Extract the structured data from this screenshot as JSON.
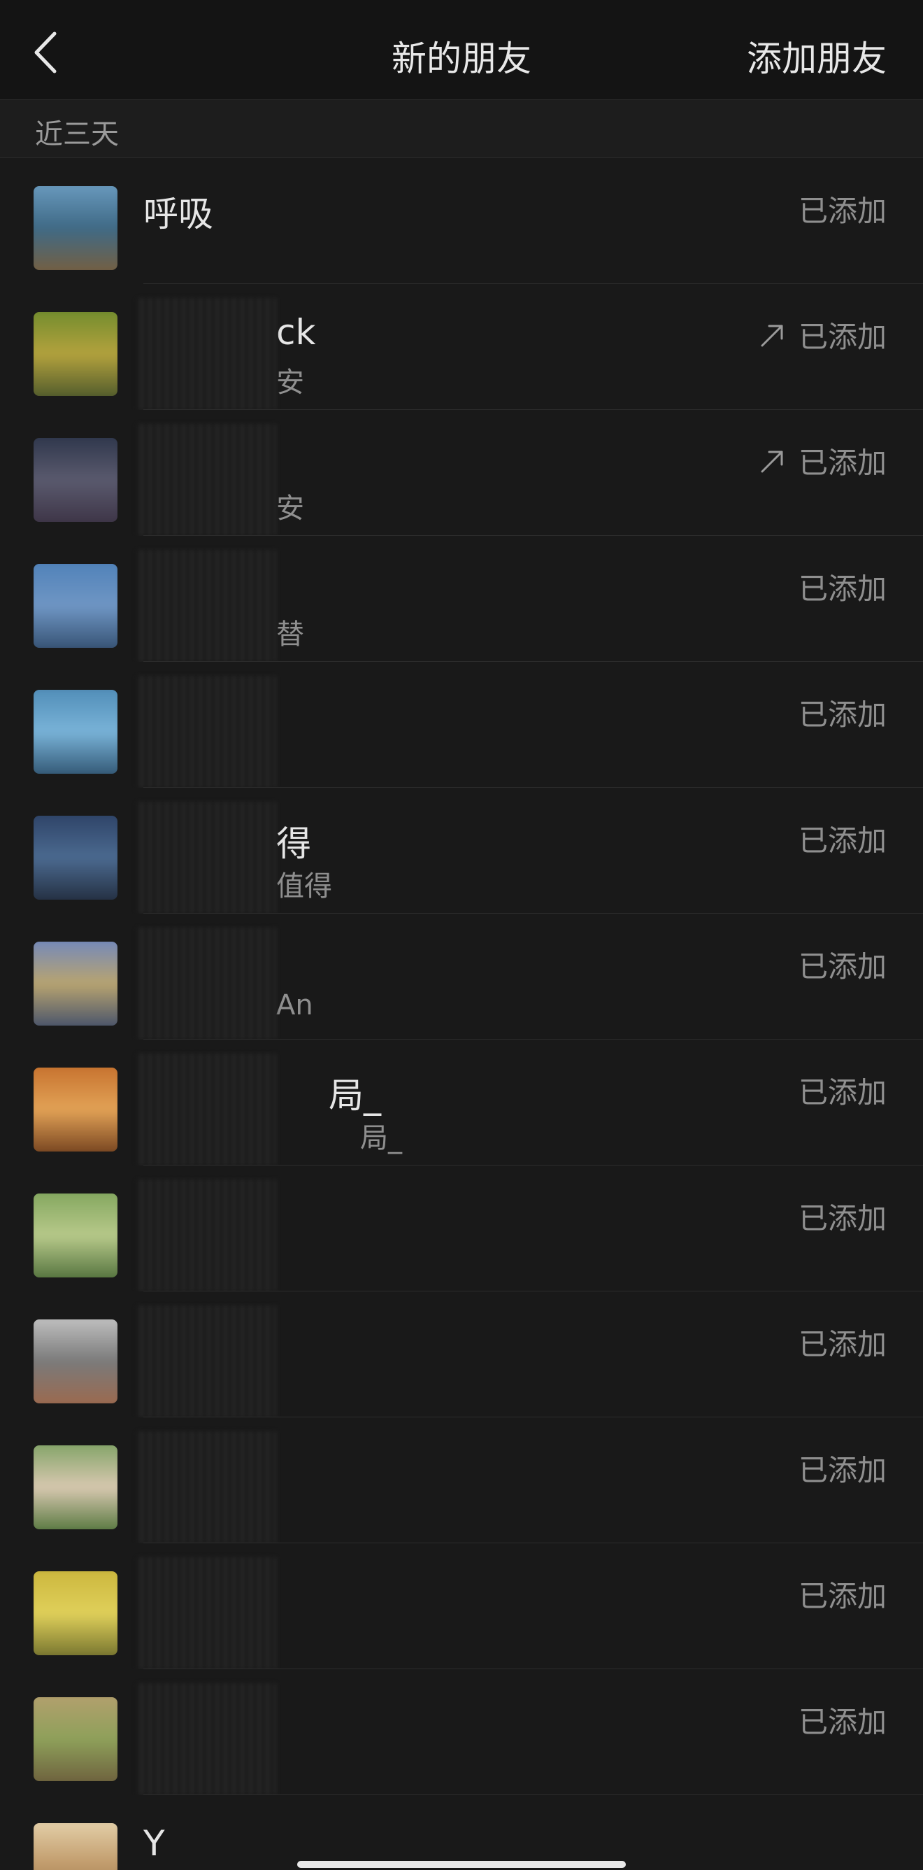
{
  "header": {
    "title": "新的朋友",
    "action_label": "添加朋友"
  },
  "section": {
    "title": "近三天"
  },
  "friends": [
    {
      "name": "呼吸",
      "sub": "",
      "status": "已添加",
      "share": false,
      "avatar_colors": [
        "#6e9fc4",
        "#3f6a86",
        "#7b5e3a"
      ]
    },
    {
      "name": "ck",
      "sub": "安",
      "status": "已添加",
      "share": true,
      "avatar_colors": [
        "#6b8a2c",
        "#b3a23d",
        "#46532a"
      ]
    },
    {
      "name": "",
      "sub": "安",
      "status": "已添加",
      "share": true,
      "avatar_colors": [
        "#2a3348",
        "#5a5a6e",
        "#3a3042"
      ]
    },
    {
      "name": "",
      "sub": "替",
      "status": "已添加",
      "share": false,
      "avatar_colors": [
        "#4d80b8",
        "#6f96c4",
        "#2f4a6a"
      ]
    },
    {
      "name": "",
      "sub": "",
      "status": "已添加",
      "share": false,
      "avatar_colors": [
        "#4c89b4",
        "#79b3d8",
        "#2a4d69"
      ]
    },
    {
      "name": "得",
      "sub": "值得",
      "status": "已添加",
      "share": false,
      "avatar_colors": [
        "#2b3f63",
        "#4b6a90",
        "#1f2838"
      ]
    },
    {
      "name": "",
      "sub": "An",
      "status": "已添加",
      "share": false,
      "avatar_colors": [
        "#6c86c4",
        "#b8a470",
        "#3c4a6a"
      ]
    },
    {
      "name": "局_",
      "sub": "局_",
      "status": "已添加",
      "share": false,
      "avatar_colors": [
        "#c46d2a",
        "#e2a256",
        "#6b3a1a"
      ]
    },
    {
      "name": "",
      "sub": "",
      "status": "已添加",
      "share": false,
      "avatar_colors": [
        "#7ea35a",
        "#b7c98a",
        "#4a6a36"
      ]
    },
    {
      "name": "",
      "sub": "",
      "status": "已添加",
      "share": false,
      "avatar_colors": [
        "#c9c9c9",
        "#7a7a7a",
        "#a0684a"
      ]
    },
    {
      "name": "",
      "sub": "",
      "status": "已添加",
      "share": false,
      "avatar_colors": [
        "#7aa060",
        "#d8c8b0",
        "#4a7034"
      ]
    },
    {
      "name": "",
      "sub": "",
      "status": "已添加",
      "share": false,
      "avatar_colors": [
        "#c9b43a",
        "#e0d05a",
        "#6a6a2a"
      ]
    },
    {
      "name": "",
      "sub": "",
      "status": "已添加",
      "share": false,
      "avatar_colors": [
        "#b7a070",
        "#8ea05a",
        "#6a5a3a"
      ]
    },
    {
      "name": "Y",
      "sub": "",
      "status": "",
      "share": false,
      "avatar_colors": [
        "#e8d6b0",
        "#c09a6a",
        "#8a6a4a"
      ]
    }
  ],
  "icons": {
    "back": "chevron-left-icon",
    "share": "arrow-up-right-icon"
  },
  "colors": {
    "background": "#191919",
    "header": "#141414",
    "section": "#1d1d1d",
    "primary_text": "#e6e6e6",
    "secondary_text": "#8f8f8f"
  }
}
